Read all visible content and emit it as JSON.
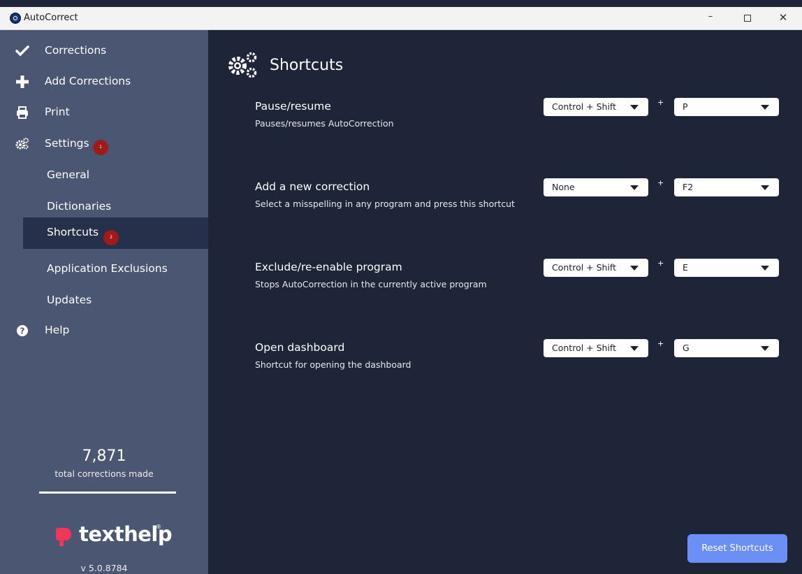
{
  "window": {
    "title": "AutoCorrect"
  },
  "sidebar": {
    "items": [
      {
        "label": "Corrections",
        "icon": "check-icon"
      },
      {
        "label": "Add Corrections",
        "icon": "plus-icon"
      },
      {
        "label": "Print",
        "icon": "printer-icon"
      },
      {
        "label": "Settings",
        "icon": "gears-icon",
        "badge": "1"
      },
      {
        "label": "Help",
        "icon": "question-icon"
      }
    ],
    "settings_sub": [
      {
        "label": "General"
      },
      {
        "label": "Dictionaries"
      },
      {
        "label": "Shortcuts",
        "badge": "2",
        "active": true
      },
      {
        "label": "Application Exclusions"
      },
      {
        "label": "Updates"
      }
    ],
    "count": "7,871",
    "count_label": "total corrections made",
    "logo": "texthelp",
    "version": "v 5.0.8784"
  },
  "main": {
    "title": "Shortcuts",
    "shortcuts": [
      {
        "title": "Pause/resume",
        "description": "Pauses/resumes AutoCorrection",
        "modifier": "Control + Shift",
        "key": "P"
      },
      {
        "title": "Add a new correction",
        "description": "Select a misspelling in any program and press this shortcut",
        "modifier": "None",
        "key": "F2"
      },
      {
        "title": "Exclude/re-enable program",
        "description": "Stops AutoCorrection in the currently active program",
        "modifier": "Control + Shift",
        "key": "E"
      },
      {
        "title": "Open dashboard",
        "description": "Shortcut for opening the dashboard",
        "modifier": "Control + Shift",
        "key": "G"
      }
    ],
    "plus_symbol": "+",
    "reset_label": "Reset Shortcuts"
  },
  "colors": {
    "sidebar_bg": "#4b5673",
    "main_bg": "#1e2538",
    "active_item_bg": "#27304a",
    "badge": "#9e1b1b",
    "button": "#6b8ff4",
    "logo_accent": "#f0365a"
  }
}
